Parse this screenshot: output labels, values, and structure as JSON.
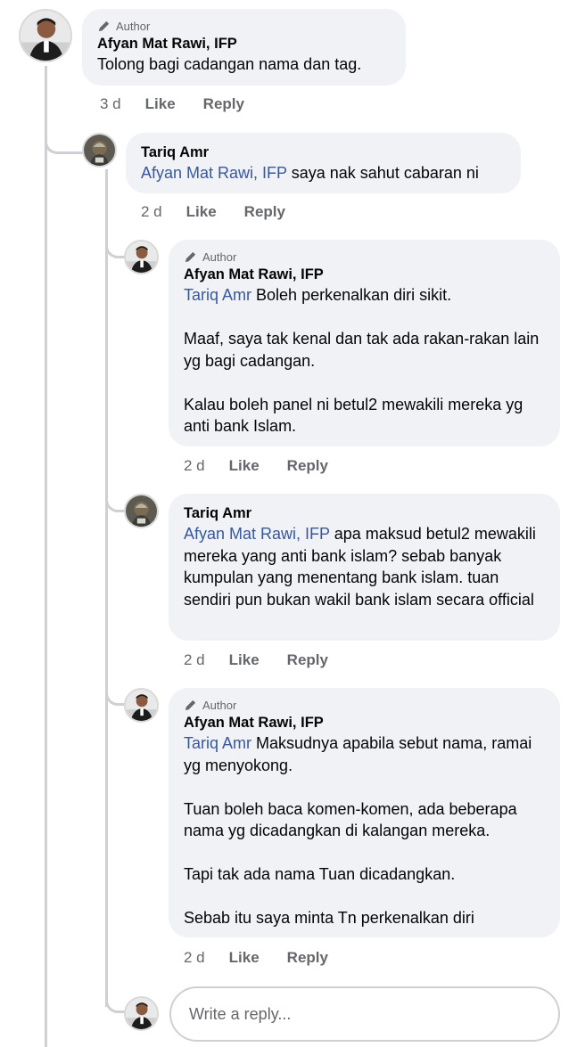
{
  "comments": [
    {
      "badge": "Author",
      "name": "Afyan Mat Rawi, IFP",
      "mention": "",
      "body": "Tolong bagi cadangan nama dan tag.",
      "time": "3 d",
      "like": "Like",
      "reply": "Reply"
    },
    {
      "badge": "",
      "name": "Tariq Amr",
      "mention": "Afyan Mat Rawi, IFP",
      "body": " saya nak sahut cabaran ni",
      "time": "2 d",
      "like": "Like",
      "reply": "Reply"
    },
    {
      "badge": "Author",
      "name": "Afyan Mat Rawi, IFP",
      "mention": "Tariq Amr",
      "body": " Boleh perkenalkan diri sikit.\n\nMaaf, saya tak kenal dan tak ada rakan-rakan lain yg bagi cadangan.\n\nKalau boleh panel ni betul2 mewakili mereka yg anti bank Islam.",
      "time": "2 d",
      "like": "Like",
      "reply": "Reply"
    },
    {
      "badge": "",
      "name": "Tariq Amr",
      "mention": "Afyan Mat Rawi, IFP",
      "body": " apa maksud betul2 mewakili mereka yang anti bank islam? sebab banyak kumpulan yang menentang bank islam. tuan sendiri pun bukan wakil bank islam secara official",
      "time": "2 d",
      "like": "Like",
      "reply": "Reply"
    },
    {
      "badge": "Author",
      "name": "Afyan Mat Rawi, IFP",
      "mention": "Tariq Amr",
      "body": " Maksudnya apabila sebut nama, ramai yg menyokong.\n\nTuan boleh baca komen-komen, ada beberapa nama yg dicadangkan di kalangan mereka.\n\nTapi tak ada nama Tuan dicadangkan.\n\nSebab itu saya minta Tn perkenalkan diri",
      "time": "2 d",
      "like": "Like",
      "reply": "Reply"
    }
  ],
  "reply_box": {
    "placeholder": "Write a reply..."
  },
  "icons": {
    "badge": "pencil-icon"
  },
  "colors": {
    "mention": "#385898",
    "bubble": "#f0f2f5",
    "line": "#ced0d4",
    "meta": "#65676b"
  }
}
